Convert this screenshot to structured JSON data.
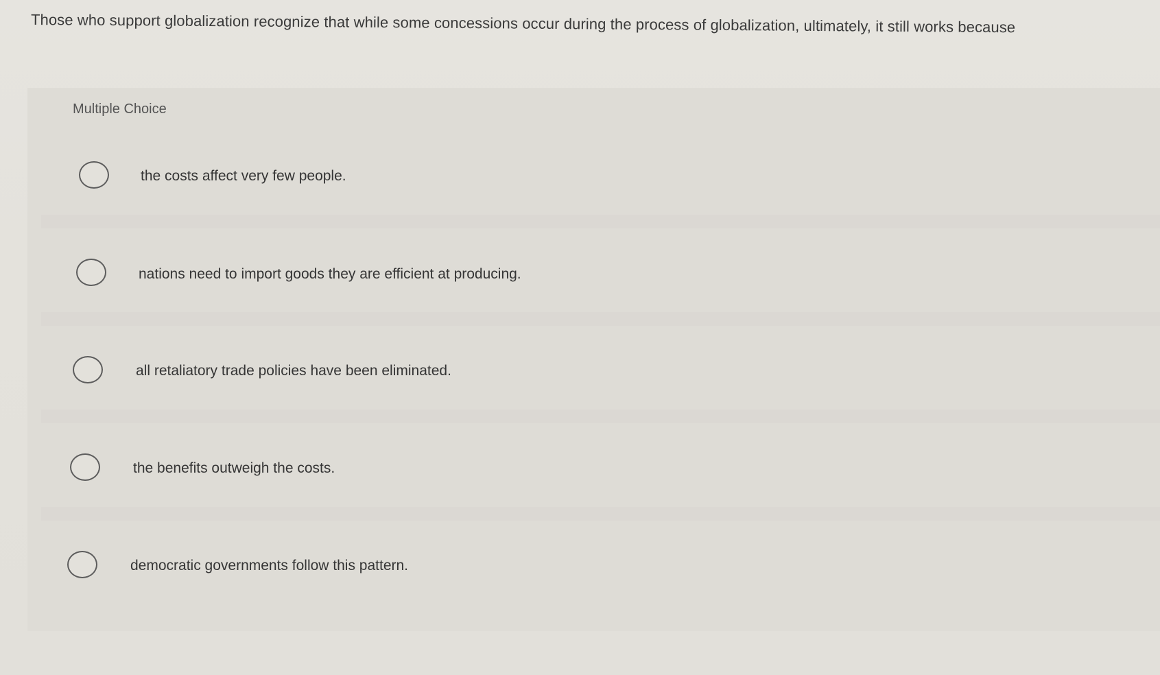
{
  "question": {
    "text": "Those who support globalization recognize that while some concessions occur during the process of globalization, ultimately, it still works because"
  },
  "panel": {
    "label": "Multiple Choice"
  },
  "options": [
    {
      "label": "the costs affect very few people."
    },
    {
      "label": "nations need to import goods they are efficient at producing."
    },
    {
      "label": "all retaliatory trade policies have been eliminated."
    },
    {
      "label": "the benefits outweigh the costs."
    },
    {
      "label": "democratic governments follow this pattern."
    }
  ]
}
